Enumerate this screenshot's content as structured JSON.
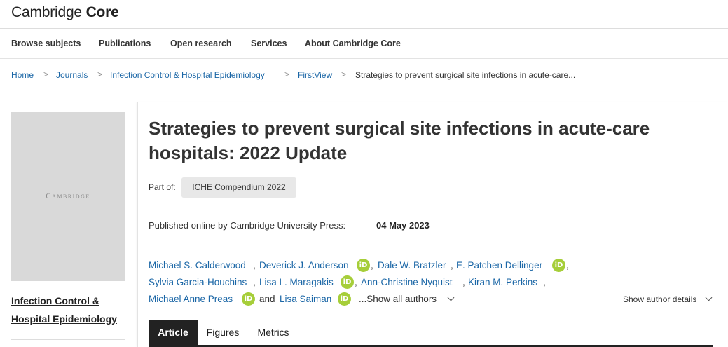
{
  "header": {
    "logo_light": "Cambridge",
    "logo_bold": "Core"
  },
  "nav": {
    "items": [
      "Browse subjects",
      "Publications",
      "Open research",
      "Services",
      "About Cambridge Core"
    ]
  },
  "breadcrumb": {
    "items": [
      "Home",
      "Journals",
      "Infection Control & Hospital Epidemiology",
      "FirstView",
      "Strategies to prevent surgical site infections in acute-care..."
    ],
    "separator": ">"
  },
  "sidebar": {
    "cover_text": "Cambridge",
    "journal_title": "Infection Control & Hospital Epidemiology"
  },
  "article": {
    "title": "Strategies to prevent surgical site infections in acute-care hospitals: 2022 Update",
    "part_of_label": "Part of:",
    "collection": "ICHE Compendium 2022",
    "published_text": "Published online by Cambridge University Press:",
    "published_date": "04 May 2023",
    "orcid_icon": "iD",
    "authors": [
      "Michael S. Calderwood",
      "Deverick J. Anderson",
      "Dale W. Bratzler",
      "E. Patchen Dellinger",
      "Sylvia Garcia-Houchins",
      "Lisa L. Maragakis",
      "Ann-Christine Nyquist",
      "Kiran M. Perkins",
      "Michael Anne Preas",
      "Lisa Saiman"
    ],
    "comma": ",",
    "and_text": "and",
    "show_all_authors": "...Show all authors",
    "show_author_details": "Show author details"
  },
  "tabs": {
    "items": [
      "Article",
      "Figures",
      "Metrics"
    ],
    "active": "Article"
  },
  "colors": {
    "link": "#1a66a6",
    "orcid": "#a6ce39",
    "active_tab": "#222222"
  }
}
